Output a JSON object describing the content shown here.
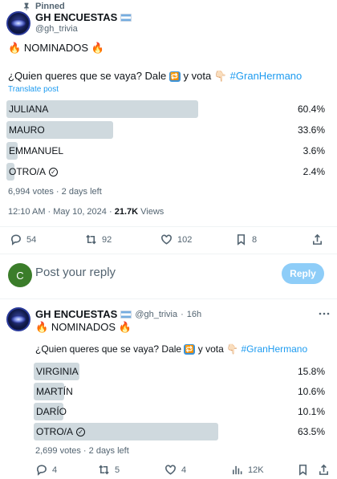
{
  "pinned_label": "Pinned",
  "tweet1": {
    "name": "GH ENCUESTAS",
    "handle": "@gh_trivia",
    "fire_emoji": "🔥",
    "heading": "NOMINADOS",
    "question_prefix": "¿Quien queres que se vaya? Dale",
    "repeat_emoji": "🔁",
    "question_middle": "y vota",
    "hand_emoji": "👇🏻",
    "hashtag": "#GranHermano",
    "translate": "Translate post",
    "poll": {
      "options": [
        {
          "label": "JULIANA",
          "percent": "60.4%",
          "share": 60.4,
          "winner": true
        },
        {
          "label": "MAURO",
          "percent": "33.6%",
          "share": 33.6,
          "winner": false
        },
        {
          "label": "EMMANUEL",
          "percent": "3.6%",
          "share": 3.6,
          "winner": false
        },
        {
          "label": "OTRO/A",
          "percent": "2.4%",
          "share": 2.4,
          "winner": false
        }
      ],
      "votes_meta": "6,994 votes · 2 days left"
    },
    "timestamp": "12:10 AM · May 10, 2024 ·",
    "views_count": "21.7K",
    "views_label": "Views",
    "actions": {
      "replies": "54",
      "reposts": "92",
      "likes": "102",
      "bookmarks": "8"
    }
  },
  "reply_box": {
    "avatar_letter": "C",
    "placeholder": "Post your reply",
    "button": "Reply"
  },
  "tweet2": {
    "name": "GH ENCUESTAS",
    "handle": "@gh_trivia",
    "separator": "·",
    "time": "16h",
    "fire_emoji": "🔥",
    "heading": "NOMINADOS",
    "question_prefix": "¿Quien queres que se vaya? Dale",
    "repeat_emoji": "🔁",
    "question_middle": "y vota",
    "hand_emoji": "👇🏻",
    "hashtag": "#GranHermano",
    "poll": {
      "options": [
        {
          "label": "VIRGINIA",
          "percent": "15.8%",
          "share": 15.8,
          "winner": false
        },
        {
          "label": "MARTÍN",
          "percent": "10.6%",
          "share": 10.6,
          "winner": false
        },
        {
          "label": "DARÍO",
          "percent": "10.1%",
          "share": 10.1,
          "winner": false
        },
        {
          "label": "OTRO/A",
          "percent": "63.5%",
          "share": 63.5,
          "winner": true
        }
      ],
      "votes_meta": "2,699 votes · 2 days left"
    },
    "actions": {
      "replies": "4",
      "reposts": "5",
      "likes": "4",
      "views": "12K"
    }
  }
}
